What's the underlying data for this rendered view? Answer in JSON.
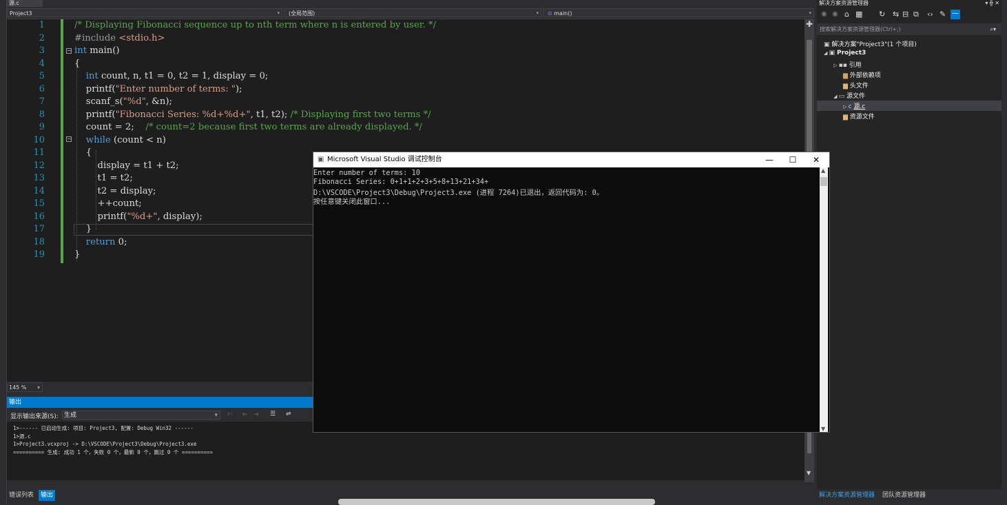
{
  "doc_tab": "源.c",
  "nav": {
    "project": "Project3",
    "scope": "(全局范围)",
    "member": "main()"
  },
  "code_lines": [
    {
      "n": "1",
      "segs": [
        {
          "c": "cm",
          "t": "/* Displaying Fibonacci sequence up to nth term where n is entered by user. */"
        }
      ]
    },
    {
      "n": "2",
      "segs": [
        {
          "c": "pp",
          "t": "#include "
        },
        {
          "c": "inc",
          "t": "<stdio.h>"
        }
      ]
    },
    {
      "n": "3",
      "segs": [
        {
          "c": "kw",
          "t": "int"
        },
        {
          "c": "",
          "t": " main()"
        }
      ]
    },
    {
      "n": "4",
      "segs": [
        {
          "c": "",
          "t": "{"
        }
      ]
    },
    {
      "n": "5",
      "segs": [
        {
          "c": "",
          "t": "    "
        },
        {
          "c": "kw",
          "t": "int"
        },
        {
          "c": "",
          "t": " count, n, t1 = 0, t2 = 1, display = 0;"
        }
      ]
    },
    {
      "n": "6",
      "segs": [
        {
          "c": "",
          "t": "    printf("
        },
        {
          "c": "st",
          "t": "\"Enter number of terms: \""
        },
        {
          "c": "",
          "t": ");"
        }
      ]
    },
    {
      "n": "7",
      "segs": [
        {
          "c": "",
          "t": "    scanf_s("
        },
        {
          "c": "st",
          "t": "\"%d\""
        },
        {
          "c": "",
          "t": ", &n);"
        }
      ]
    },
    {
      "n": "8",
      "segs": [
        {
          "c": "",
          "t": "    printf("
        },
        {
          "c": "st",
          "t": "\"Fibonacci Series: %d+%d+\""
        },
        {
          "c": "",
          "t": ", t1, t2); "
        },
        {
          "c": "cm",
          "t": "/* Displaying first two terms */"
        }
      ]
    },
    {
      "n": "9",
      "segs": [
        {
          "c": "",
          "t": "    count = 2;    "
        },
        {
          "c": "cm",
          "t": "/* count=2 because first two terms are already displayed. */"
        }
      ]
    },
    {
      "n": "10",
      "segs": [
        {
          "c": "",
          "t": "    "
        },
        {
          "c": "kw",
          "t": "while"
        },
        {
          "c": "",
          "t": " (count < n)"
        }
      ]
    },
    {
      "n": "11",
      "segs": [
        {
          "c": "",
          "t": "    {"
        }
      ]
    },
    {
      "n": "12",
      "segs": [
        {
          "c": "",
          "t": "        display = t1 + t2;"
        }
      ]
    },
    {
      "n": "13",
      "segs": [
        {
          "c": "",
          "t": "        t1 = t2;"
        }
      ]
    },
    {
      "n": "14",
      "segs": [
        {
          "c": "",
          "t": "        t2 = display;"
        }
      ]
    },
    {
      "n": "15",
      "segs": [
        {
          "c": "",
          "t": "        ++count;"
        }
      ]
    },
    {
      "n": "16",
      "segs": [
        {
          "c": "",
          "t": "        printf("
        },
        {
          "c": "st",
          "t": "\"%d+\""
        },
        {
          "c": "",
          "t": ", display);"
        }
      ]
    },
    {
      "n": "17",
      "segs": [
        {
          "c": "",
          "t": "    }"
        }
      ]
    },
    {
      "n": "18",
      "segs": [
        {
          "c": "",
          "t": "    "
        },
        {
          "c": "kw",
          "t": "return"
        },
        {
          "c": "",
          "t": " 0;"
        }
      ]
    },
    {
      "n": "19",
      "segs": [
        {
          "c": "",
          "t": "}"
        }
      ]
    }
  ],
  "zoom": "145 %",
  "output": {
    "title": "输出",
    "source_label": "显示输出来源(S):",
    "source_value": "生成",
    "lines": [
      "1>------ 已启动生成: 项目: Project3, 配置: Debug Win32 ------",
      "1>源.c",
      "1>Project3.vcxproj -> D:\\VSCODE\\Project3\\Debug\\Project3.exe",
      "========== 生成: 成功 1 个，失败 0 个，最新 0 个，跳过 0 个 =========="
    ]
  },
  "bottom_tabs": [
    "错误列表",
    "输出"
  ],
  "solution": {
    "title": "解决方案资源管理器",
    "search_placeholder": "搜索解决方案资源管理器(Ctrl+;)",
    "root": "解决方案\"Project3\"(1 个项目)",
    "project": "Project3",
    "items": [
      "引用",
      "外部依赖项",
      "头文件",
      "源文件",
      "源.c",
      "资源文件"
    ],
    "tabs": [
      "解决方案资源管理器",
      "团队资源管理器"
    ]
  },
  "console": {
    "title": "Microsoft Visual Studio 调试控制台",
    "lines": [
      "Enter number of terms: 10",
      "Fibonacci Series: 0+1+1+2+3+5+8+13+21+34+",
      "D:\\VSCODE\\Project3\\Debug\\Project3.exe (进程 7264)已退出，返回代码为: 0。",
      "按任意键关闭此窗口..."
    ]
  }
}
